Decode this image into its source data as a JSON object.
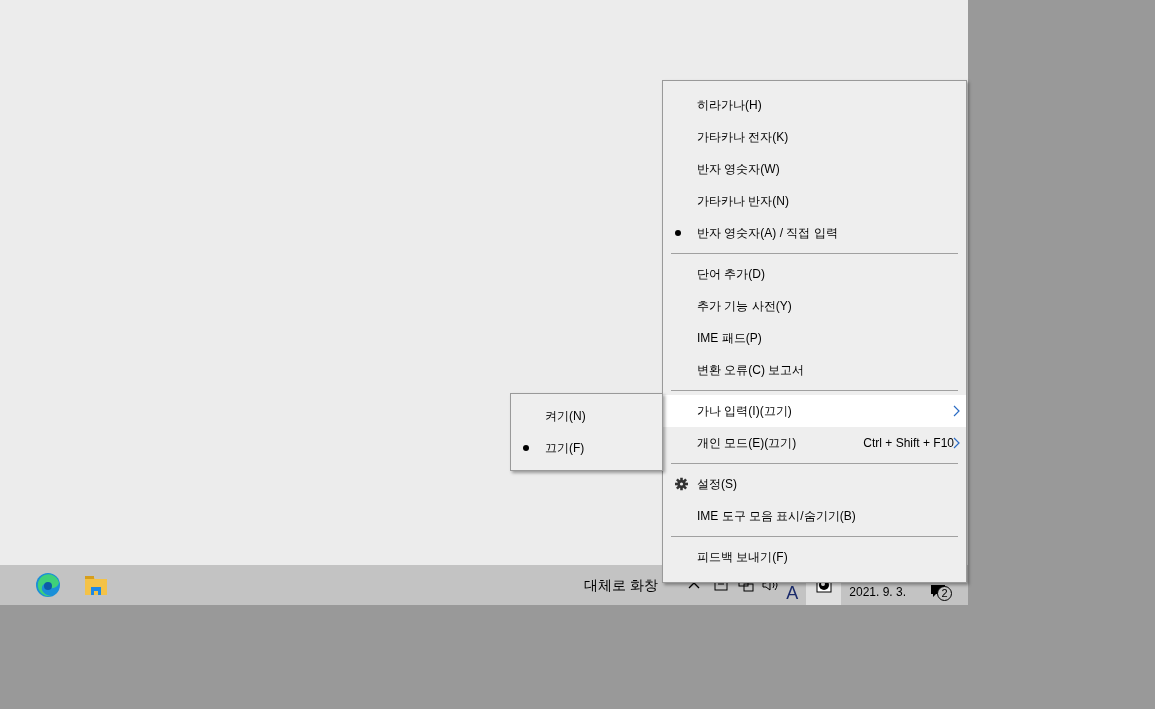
{
  "taskbar": {
    "weather": "대체로 화창",
    "ime_mode": "A",
    "date": "2021. 9. 3.",
    "notification_count": "2"
  },
  "menu": {
    "items": [
      {
        "kind": "item",
        "label": "히라가나(H)",
        "checked": false,
        "highlighted": false
      },
      {
        "kind": "item",
        "label": "가타카나 전자(K)",
        "checked": false,
        "highlighted": false
      },
      {
        "kind": "item",
        "label": "반자 영숫자(W)",
        "checked": false,
        "highlighted": false
      },
      {
        "kind": "item",
        "label": "가타카나 반자(N)",
        "checked": false,
        "highlighted": false
      },
      {
        "kind": "item",
        "label": "반자 영숫자(A) / 직접 입력",
        "checked": true,
        "highlighted": false
      },
      {
        "kind": "separator"
      },
      {
        "kind": "item",
        "label": "단어 추가(D)",
        "checked": false,
        "highlighted": false
      },
      {
        "kind": "item",
        "label": "추가 기능 사전(Y)",
        "checked": false,
        "highlighted": false
      },
      {
        "kind": "item",
        "label": "IME 패드(P)",
        "checked": false,
        "highlighted": false
      },
      {
        "kind": "item",
        "label": "변환 오류(C) 보고서",
        "checked": false,
        "highlighted": false
      },
      {
        "kind": "separator"
      },
      {
        "kind": "item",
        "label": "가나 입력(I)(끄기)",
        "checked": false,
        "highlighted": true,
        "submenu": true
      },
      {
        "kind": "item",
        "label": "개인 모드(E)(끄기)",
        "shortcut": "Ctrl + Shift + F10",
        "checked": false,
        "highlighted": false,
        "submenu": true
      },
      {
        "kind": "separator"
      },
      {
        "kind": "settings",
        "label": "설정(S)",
        "checked": false,
        "highlighted": false
      },
      {
        "kind": "item",
        "label": "IME 도구 모음 표시/숨기기(B)",
        "checked": false,
        "highlighted": false
      },
      {
        "kind": "separator"
      },
      {
        "kind": "item",
        "label": "피드백 보내기(F)",
        "checked": false,
        "highlighted": false
      }
    ]
  },
  "submenu": {
    "items": [
      {
        "label": "켜기(N)",
        "checked": false
      },
      {
        "label": "끄기(F)",
        "checked": true
      }
    ]
  }
}
